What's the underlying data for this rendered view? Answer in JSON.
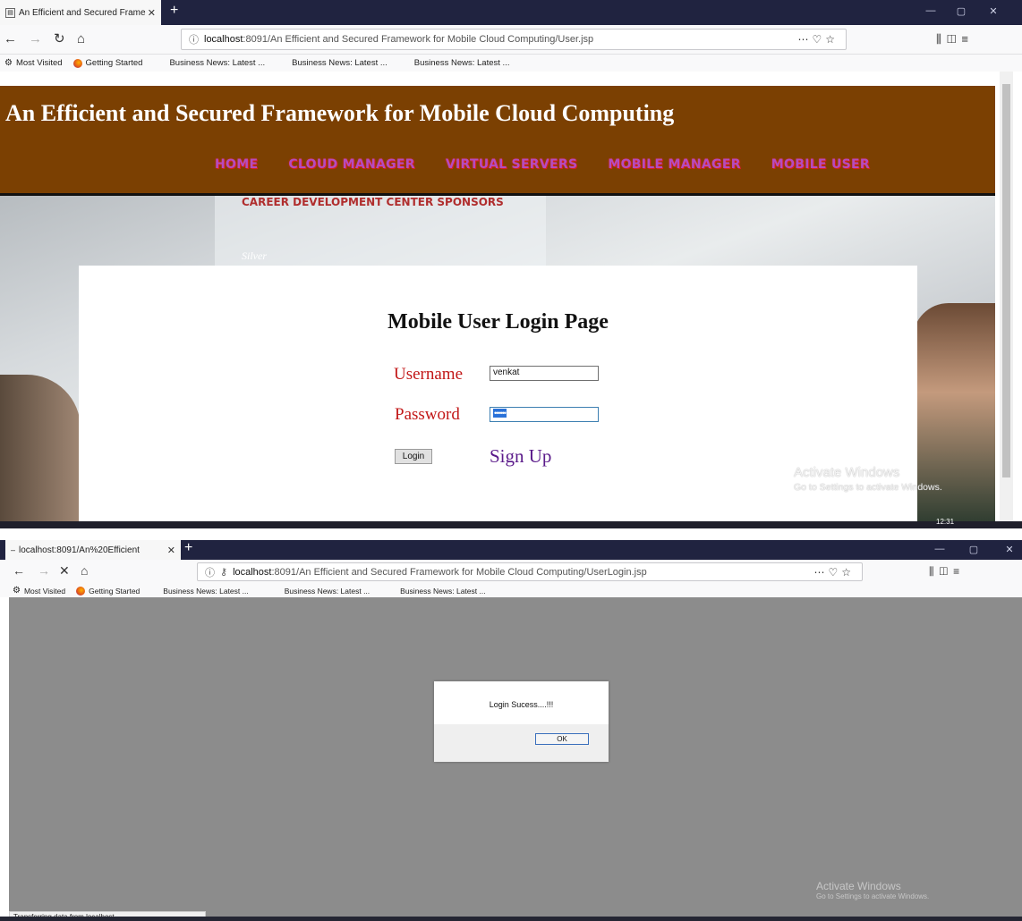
{
  "window1": {
    "tab_title": "An Efficient and Secured Frame",
    "url_host": "localhost",
    "url_rest": ":8091/An Efficient and Secured Framework for Mobile Cloud Computing/User.jsp",
    "bookmarks": [
      "Most Visited",
      "Getting Started",
      "Business News: Latest ...",
      "Business News: Latest ...",
      "Business News: Latest ..."
    ],
    "site_title": "An Efficient and Secured Framework for Mobile Cloud Computing",
    "menu": [
      "HOME",
      "CLOUD MANAGER",
      "VIRTUAL SERVERS",
      "MOBILE MANAGER",
      "MOBILE USER"
    ],
    "banner_text": "CAREER DEVELOPMENT CENTER SPONSORS",
    "banner_text2": "Silver",
    "login": {
      "title": "Mobile User Login Page",
      "username_label": "Username",
      "username_value": "venkat",
      "password_label": "Password",
      "password_value": "••••••",
      "login_button": "Login",
      "signup_link": "Sign Up"
    },
    "watermark_title": "Activate Windows",
    "watermark_sub": "Go to Settings to activate Windows.",
    "clock": "12:31"
  },
  "window2": {
    "tab_title": "localhost:8091/An%20Efficient",
    "url_host": "localhost",
    "url_rest": ":8091/An Efficient and Secured Framework for Mobile Cloud Computing/UserLogin.jsp",
    "bookmarks": [
      "Most Visited",
      "Getting Started",
      "Business News: Latest ...",
      "Business News: Latest ...",
      "Business News: Latest ..."
    ],
    "alert_message": "Login Sucess....!!!",
    "ok_button": "OK",
    "watermark_title": "Activate Windows",
    "watermark_sub": "Go to Settings to activate Windows.",
    "status_text": "Transferring data from localhost..."
  },
  "colors": {
    "tabbar": "#202340",
    "header_brown": "#7b4002",
    "menu_text": "#b44cc0",
    "label_red": "#c21818",
    "signup_purple": "#5a1a8a",
    "dialog_backdrop": "#8c8c8c"
  },
  "icons": [
    "back-icon",
    "forward-icon",
    "reload-icon",
    "stop-icon",
    "home-icon",
    "info-icon",
    "key-icon",
    "more-icon",
    "pocket-icon",
    "star-icon",
    "library-icon",
    "sidebar-icon",
    "menu-icon",
    "gear-icon",
    "firefox-icon",
    "close-icon",
    "add-tab-icon",
    "minimize-icon",
    "maximize-icon"
  ]
}
